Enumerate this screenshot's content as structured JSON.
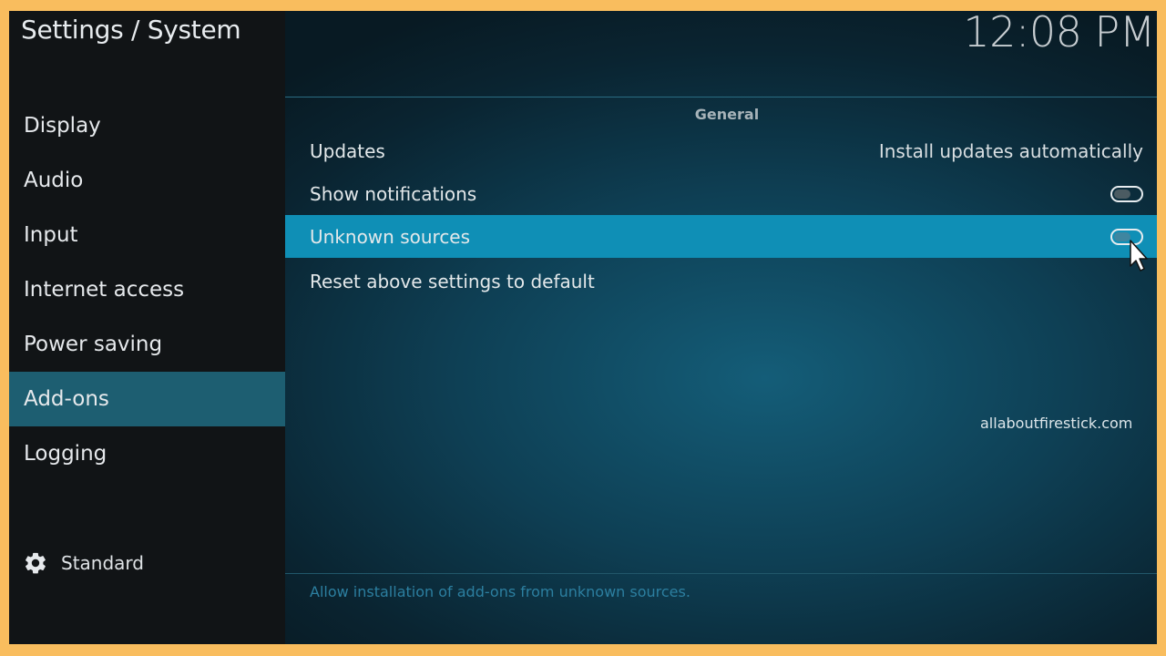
{
  "window": {
    "title": "Settings / System",
    "clock": "12:08 PM"
  },
  "sidebar": {
    "items": [
      {
        "label": "Display"
      },
      {
        "label": "Audio"
      },
      {
        "label": "Input"
      },
      {
        "label": "Internet access"
      },
      {
        "label": "Power saving"
      },
      {
        "label": "Add-ons",
        "active": true
      },
      {
        "label": "Logging"
      }
    ],
    "settings_level": {
      "icon": "gear-icon",
      "label": "Standard"
    }
  },
  "main": {
    "section_title": "General",
    "rows": [
      {
        "label": "Updates",
        "value": "Install updates automatically"
      },
      {
        "label": "Show notifications",
        "control": "toggle",
        "enabled": false
      },
      {
        "label": "Unknown sources",
        "control": "toggle",
        "enabled": false,
        "focused": true
      },
      {
        "label": "Reset above settings to default"
      }
    ],
    "description": "Allow installation of add-ons from unknown sources."
  },
  "watermark": "allaboutfirestick.com",
  "colors": {
    "frame": "#f9bd5e",
    "active_nav": "#1d5e71",
    "focused_row": "#0f8fb6"
  }
}
